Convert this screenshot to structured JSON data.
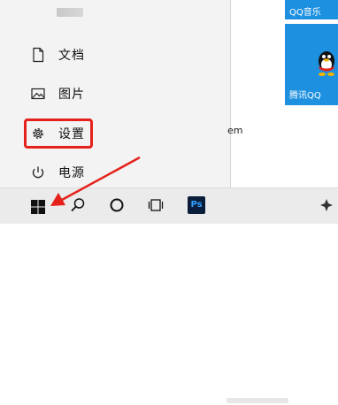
{
  "start_menu": {
    "items": [
      {
        "label": "文档",
        "icon": "document-icon"
      },
      {
        "label": "图片",
        "icon": "pictures-icon"
      },
      {
        "label": "设置",
        "icon": "gear-icon"
      },
      {
        "label": "电源",
        "icon": "power-icon"
      }
    ],
    "highlighted_item": "设置",
    "highlight_color": "#e5211b"
  },
  "tiles": {
    "music": {
      "label": "QQ音乐"
    },
    "qq": {
      "label": "腾讯QQ"
    },
    "color": "#1e90e0"
  },
  "background_text": "em",
  "taskbar": {
    "ps_label": "Ps",
    "icons": [
      "windows-start-icon",
      "search-icon",
      "cortana-icon",
      "task-view-icon",
      "photoshop-icon",
      "app-icon"
    ]
  },
  "annotation": {
    "arrow_color": "#e5211b"
  }
}
